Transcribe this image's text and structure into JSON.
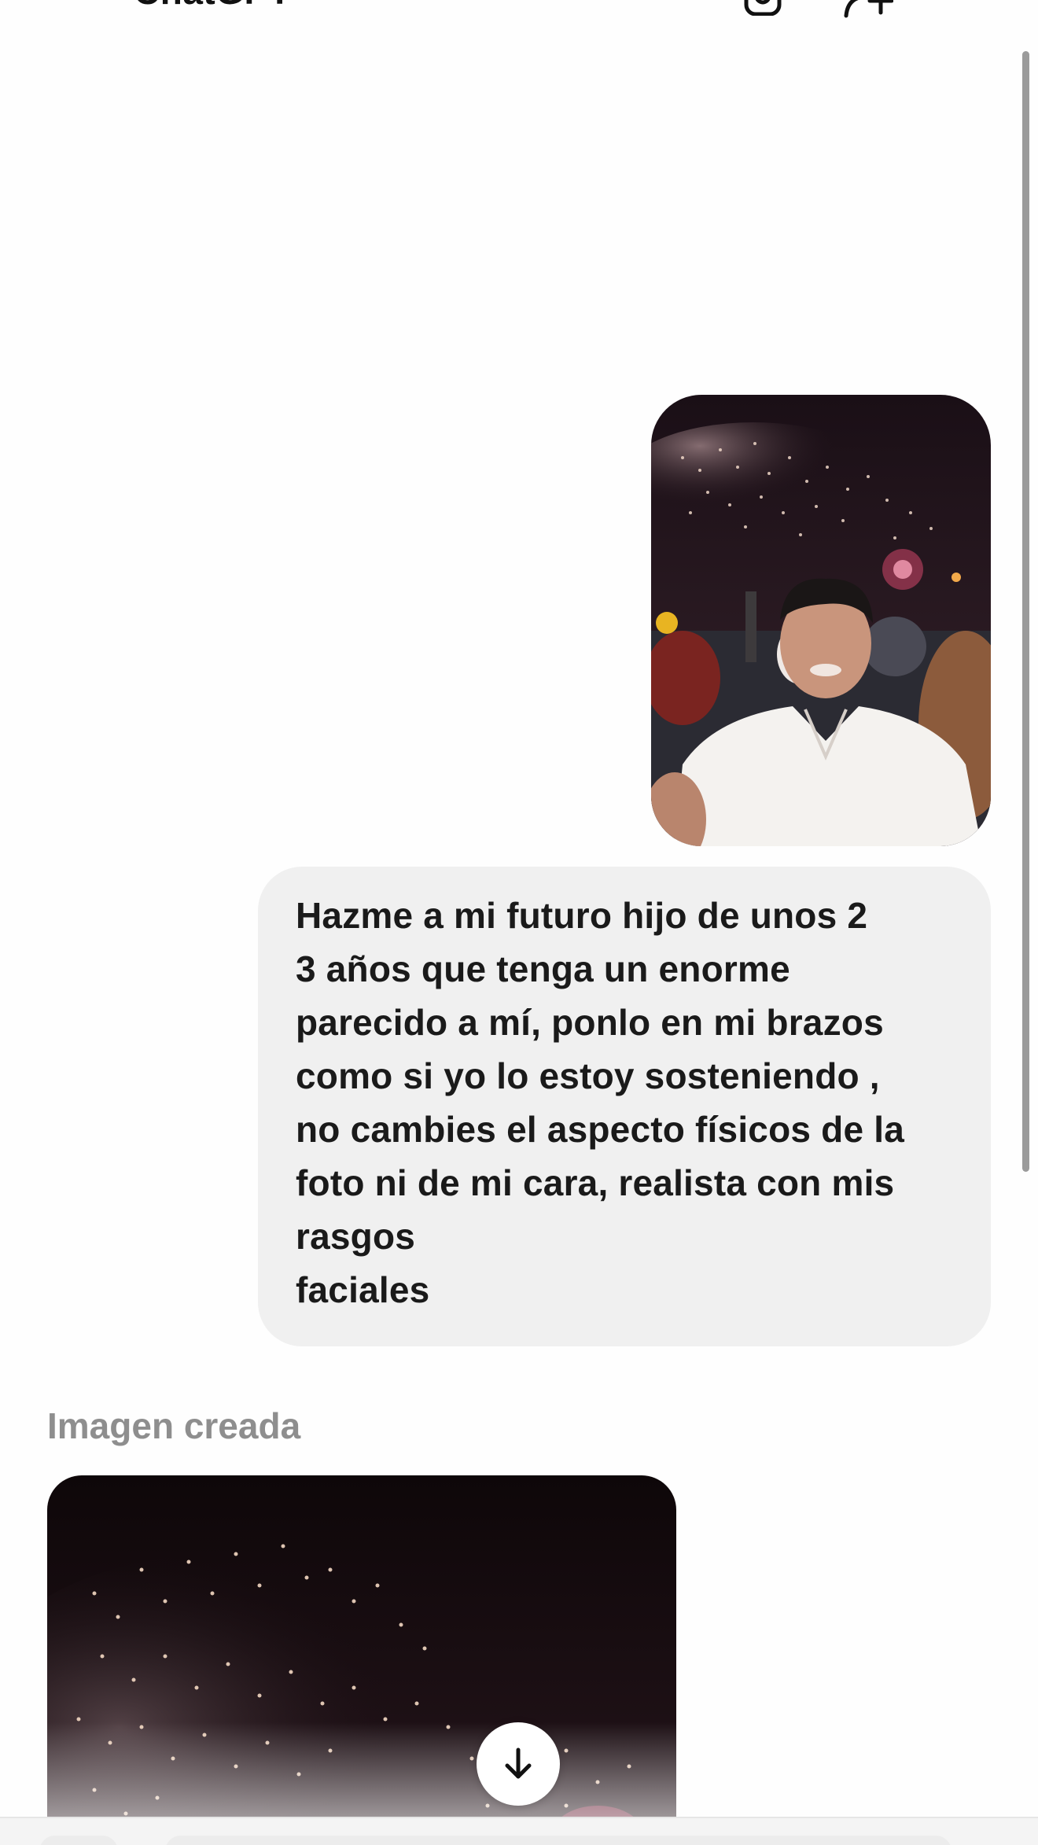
{
  "header": {
    "title": "ChatGPT",
    "menu_icon": "hamburger-menu-icon",
    "temp_chat_icon": "temporary-chat-icon",
    "add_person_icon": "add-person-icon"
  },
  "conversation": {
    "user_message": {
      "attachment_icon": "photo-thumbnail",
      "lines": [
        "Hazme a mi futuro hijo de unos 2",
        "3 años que tenga un enorme",
        "parecido a mí, ponlo en mi brazos",
        "como si yo lo estoy sosteniendo ,",
        "no cambies el aspecto físicos de la",
        "foto ni de mi cara, realista con mis",
        "rasgos",
        "faciales"
      ]
    },
    "assistant_response": {
      "label": "Imagen creada"
    }
  },
  "scroll_down_button": {
    "icon": "arrow-down-icon"
  },
  "colors": {
    "background": "#fefefe",
    "bubble": "#f0f0f0",
    "label": "#8e8e8e",
    "scrollbar": "#9b9b9b"
  }
}
